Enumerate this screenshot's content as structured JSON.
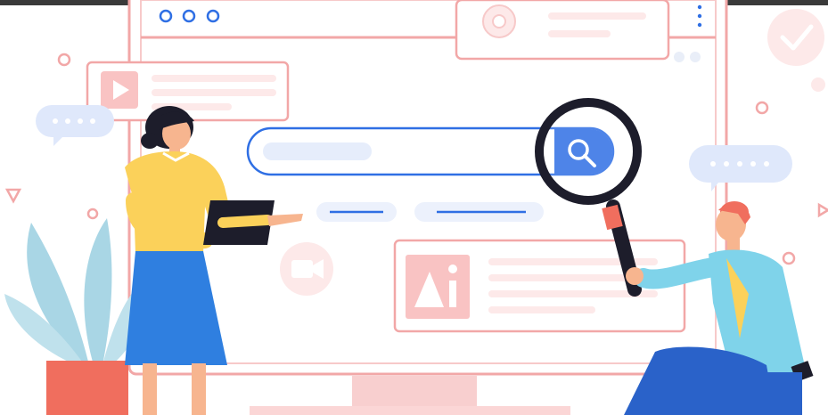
{
  "scene": {
    "description_free": true,
    "colors": {
      "outline": "#f2a7a7",
      "panel": "#ffffff",
      "soft": "#fde9e9",
      "accent_blue": "#2f6fe4",
      "light_blue": "#dfe8fb",
      "yellow": "#fbd15a",
      "skirt": "#2f7fe0",
      "shirt_man": "#7fd3ea",
      "pants_man": "#2a62c9",
      "plant": "#a9d6e5",
      "pot": "#f06e5e",
      "dark": "#1d1d2b",
      "skin": "#f7b58f"
    },
    "icons": [
      "window-dots-icon",
      "gear-icon",
      "check-icon",
      "play-icon",
      "search-icon",
      "magnifier-icon",
      "image-icon",
      "video-camera-icon",
      "chat-bubble-icon"
    ]
  }
}
